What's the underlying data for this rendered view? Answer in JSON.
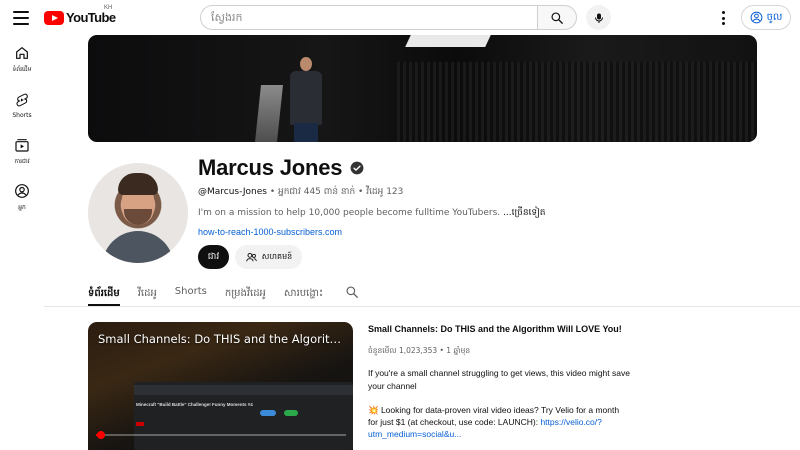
{
  "header": {
    "logo_text": "YouTube",
    "country_code": "KH",
    "search_placeholder": "ស្វែងរក",
    "signin_label": "ចូល"
  },
  "sidenav": {
    "items": [
      {
        "label": "ទំព័រដើម",
        "icon": "home-icon"
      },
      {
        "label": "Shorts",
        "icon": "shorts-icon"
      },
      {
        "label": "ការជាវ",
        "icon": "subscriptions-icon"
      },
      {
        "label": "អ្នក",
        "icon": "you-icon"
      }
    ]
  },
  "channel": {
    "name": "Marcus Jones",
    "handle": "@Marcus-Jones",
    "stats": " • អ្នកជាវ 445 ពាន់ នាក់ • វីដេអូ 123",
    "description": "I'm on a mission to help 10,000 people become fulltime YouTubers. ",
    "description_more": "...ច្រើនទៀត",
    "link": "how-to-reach-1000-subscribers.com",
    "subscribe_label": "ជាវ",
    "join_label": "សហគមន៍"
  },
  "tabs": [
    {
      "label": "ទំព័រដើម",
      "active": true
    },
    {
      "label": "វីដេអូ",
      "active": false
    },
    {
      "label": "Shorts",
      "active": false
    },
    {
      "label": "កម្រងវីដេអូ",
      "active": false
    },
    {
      "label": "សារបង្ហោះ",
      "active": false
    }
  ],
  "featured_video": {
    "player_title": "Small Channels: Do THIS and the Algorithm Wi…",
    "inner_title": "Minecraft \"Build Battle\" Challenge! Funny Moments #4",
    "title": "Small Channels: Do THIS and the Algorithm Will LOVE You!",
    "meta": "ចំនួនមើល 1,023,353 • 1 ឆ្នាំមុន",
    "description": "If you're a small channel struggling to get views, this video might save your channel",
    "promo": "💥 Looking for data-proven viral video ideas? Try Velio for a month for just $1 (at checkout, use code: LAUNCH):",
    "promo_link": "https://velio.co/?utm_medium=social&u...",
    "progress_fraction": 0.02
  },
  "colors": {
    "brand_red": "#ff0000",
    "link_blue": "#065fd4",
    "text_primary": "#0f0f0f",
    "text_secondary": "#606060"
  }
}
